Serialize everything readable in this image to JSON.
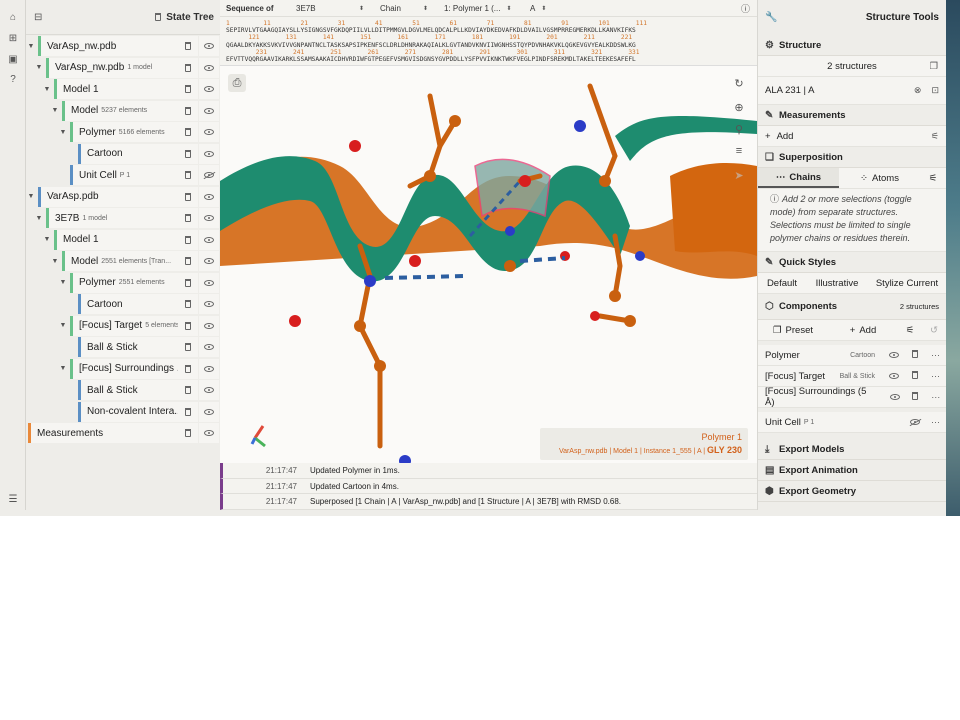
{
  "state_tree": {
    "title": "State Tree",
    "rows": [
      {
        "label": "VarAsp_nw.pdb",
        "sub": ""
      },
      {
        "label": "VarAsp_nw.pdb",
        "sub": "1 model"
      },
      {
        "label": "Model 1",
        "sub": ""
      },
      {
        "label": "Model",
        "sub": "5237 elements"
      },
      {
        "label": "Polymer",
        "sub": "5166 elements"
      },
      {
        "label": "Cartoon",
        "sub": ""
      },
      {
        "label": "Unit Cell",
        "sub": "P 1"
      },
      {
        "label": "VarAsp.pdb",
        "sub": ""
      },
      {
        "label": "3E7B",
        "sub": "1 model"
      },
      {
        "label": "Model 1",
        "sub": ""
      },
      {
        "label": "Model",
        "sub": "2551 elements [Tran..."
      },
      {
        "label": "Polymer",
        "sub": "2551 elements"
      },
      {
        "label": "Cartoon",
        "sub": ""
      },
      {
        "label": "[Focus] Target",
        "sub": "5 elements"
      },
      {
        "label": "Ball & Stick",
        "sub": ""
      },
      {
        "label": "[Focus] Surroundings ...",
        "sub": ""
      },
      {
        "label": "Ball & Stick",
        "sub": ""
      },
      {
        "label": "Non-covalent Intera...",
        "sub": ""
      },
      {
        "label": "Measurements",
        "sub": ""
      }
    ]
  },
  "sequence": {
    "label": "Sequence of",
    "structure": "3E7B",
    "mode": "Chain",
    "entity": "1: Polymer 1 (...",
    "chain": "A",
    "line1_nums": "1         11        21        31        41        51        61        71        81        91        101       111",
    "line1": "SEPIRVLVTGAAGQIAYSLLYSIGNGSVFGKDQPIILVLLDITPMMGVLDGVLMELQDCALPLLKDVIAYDKEDVAFKDLDVAILVGSMPRREGMERKDLLKANVKIFKS",
    "line2_nums": "      121       131       141       151       161       171       181       191       201       211       221",
    "line2": "QGAALDKYAKKSVKVIVVGNPANTNCLTASKSAPSIPKENFSCLDRLDHNRAKAQIALKLGVTANDVKNVIIWGNHSSTQYPDVNHAKVKLQGKEVGVYEALKDDSWLKG",
    "line3_nums": "        231       241       251       261       271       281       291       301       311       321       331",
    "line3": "EFVTTVQQRGAAVIKARKLSSAMSAAKAICDHVRDIWFGTPEGEFVSMGVISDGNSYGVPDDLLYSFPVVIKNKTWKFVEGLPINDFSREKMDLTAKELTEEKESAFEFL"
  },
  "viewport": {
    "hover_title": "Polymer 1",
    "hover_path": "VarAsp_nw.pdb | Model 1 | Instance 1_555 | A |",
    "hover_residue": "GLY 230",
    "colors": {
      "teal": "#1e8c6f",
      "orange": "#d3660f",
      "nitrogen": "#2b3cc7",
      "oxygen": "#d81e1e",
      "highlight": "#e8447a"
    }
  },
  "log": [
    {
      "time": "21:17:47",
      "msg": "Updated Polymer in 1ms."
    },
    {
      "time": "21:17:47",
      "msg": "Updated Cartoon in 4ms."
    },
    {
      "time": "21:17:47",
      "msg": "Superposed [1 Chain | A | VarAsp_nw.pdb] and [1 Structure | A | 3E7B] with RMSD 0.68."
    }
  ],
  "right_panel": {
    "title": "Structure Tools",
    "structure_label": "Structure",
    "structure_count": "2 structures",
    "selection": "ALA 231 | A",
    "measurements_label": "Measurements",
    "add_label": "Add",
    "superposition_label": "Superposition",
    "chains_tab": "Chains",
    "atoms_tab": "Atoms",
    "help_text": "Add 2 or more selections (toggle mode) from separate structures. Selections must be limited to single polymer chains or residues therein.",
    "quick_styles_label": "Quick Styles",
    "qs_default": "Default",
    "qs_illustrative": "Illustrative",
    "qs_stylize": "Stylize Current",
    "components_label": "Components",
    "components_count": "2 structures",
    "preset_label": "Preset",
    "comp_add_label": "Add",
    "components": [
      {
        "label": "Polymer",
        "rep": "Cartoon"
      },
      {
        "label": "[Focus] Target",
        "rep": "Ball & Stick"
      },
      {
        "label": "[Focus] Surroundings (5 Å)",
        "rep": ""
      }
    ],
    "unit_cell_label": "Unit Cell",
    "unit_cell_sub": "P 1",
    "export_models": "Export Models",
    "export_animation": "Export Animation",
    "export_geometry": "Export Geometry"
  }
}
